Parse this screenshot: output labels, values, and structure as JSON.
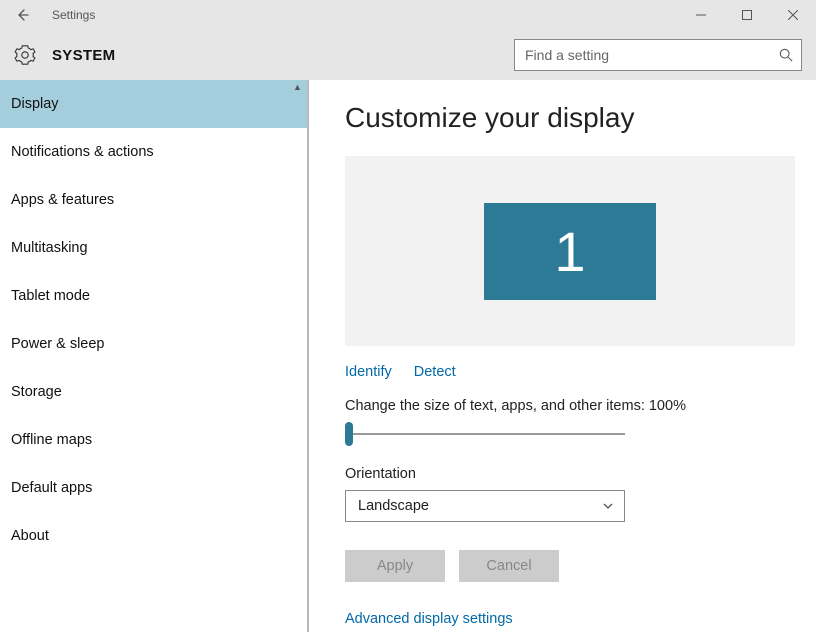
{
  "titlebar": {
    "title": "Settings"
  },
  "header": {
    "title": "SYSTEM",
    "search_placeholder": "Find a setting"
  },
  "sidebar": {
    "items": [
      {
        "label": "Display",
        "selected": true
      },
      {
        "label": "Notifications & actions",
        "selected": false
      },
      {
        "label": "Apps & features",
        "selected": false
      },
      {
        "label": "Multitasking",
        "selected": false
      },
      {
        "label": "Tablet mode",
        "selected": false
      },
      {
        "label": "Power & sleep",
        "selected": false
      },
      {
        "label": "Storage",
        "selected": false
      },
      {
        "label": "Offline maps",
        "selected": false
      },
      {
        "label": "Default apps",
        "selected": false
      },
      {
        "label": "About",
        "selected": false
      }
    ]
  },
  "main": {
    "heading": "Customize your display",
    "monitor_label": "1",
    "identify_link": "Identify",
    "detect_link": "Detect",
    "scale_label": "Change the size of text, apps, and other items: 100%",
    "orientation_label": "Orientation",
    "orientation_value": "Landscape",
    "apply_label": "Apply",
    "cancel_label": "Cancel",
    "advanced_link": "Advanced display settings"
  }
}
